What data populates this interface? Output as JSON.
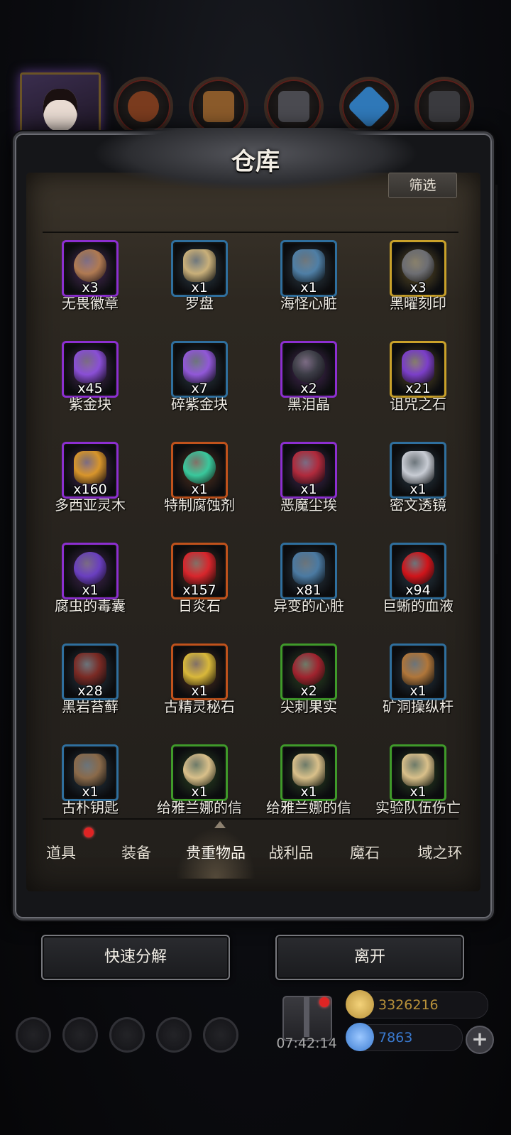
{
  "warehouse": {
    "title": "仓库",
    "filter_label": "筛选"
  },
  "items": [
    {
      "name": "无畏徽章",
      "qty": "x3",
      "rarity": "purple",
      "icon": "rune-medal-icon",
      "icon_color": "#b07a52"
    },
    {
      "name": "罗盘",
      "qty": "x1",
      "rarity": "blue",
      "icon": "compass-icon",
      "icon_color": "#c9b07a"
    },
    {
      "name": "海怪心脏",
      "qty": "x1",
      "rarity": "blue",
      "icon": "heart-icon",
      "icon_color": "#4f7fa6"
    },
    {
      "name": "黑曜刻印",
      "qty": "x3",
      "rarity": "gold",
      "icon": "obsidian-stone-icon",
      "icon_color": "#6d6e73"
    },
    {
      "name": "紫金块",
      "qty": "x45",
      "rarity": "purple",
      "icon": "crystal-icon",
      "icon_color": "#8a4fd6"
    },
    {
      "name": "碎紫金块",
      "qty": "x7",
      "rarity": "blue",
      "icon": "crystal-shard-icon",
      "icon_color": "#9158d8"
    },
    {
      "name": "黑泪晶",
      "qty": "x2",
      "rarity": "purple",
      "icon": "black-tear-icon",
      "icon_color": "#3b3c45"
    },
    {
      "name": "诅咒之石",
      "qty": "x21",
      "rarity": "gold",
      "icon": "cursed-stone-icon",
      "icon_color": "#7b3ec9"
    },
    {
      "name": "多西亚灵木",
      "qty": "x160",
      "rarity": "purple",
      "icon": "wood-log-icon",
      "icon_color": "#d8952b"
    },
    {
      "name": "特制腐蚀剂",
      "qty": "x1",
      "rarity": "orange",
      "icon": "potion-flask-icon",
      "icon_color": "#39c89c"
    },
    {
      "name": "恶魔尘埃",
      "qty": "x1",
      "rarity": "purple",
      "icon": "dust-pile-icon",
      "icon_color": "#b02a3c"
    },
    {
      "name": "密文透镜",
      "qty": "x1",
      "rarity": "blue",
      "icon": "lens-icon",
      "icon_color": "#c8ccd4"
    },
    {
      "name": "腐虫的毒囊",
      "qty": "x1",
      "rarity": "purple",
      "icon": "poison-sac-icon",
      "icon_color": "#6a3fc0"
    },
    {
      "name": "日炎石",
      "qty": "x157",
      "rarity": "orange",
      "icon": "ember-stone-icon",
      "icon_color": "#d8262c"
    },
    {
      "name": "异变的心脏",
      "qty": "x81",
      "rarity": "blue",
      "icon": "mutant-heart-icon",
      "icon_color": "#4b7aa2"
    },
    {
      "name": "巨蜥的血液",
      "qty": "x94",
      "rarity": "blue",
      "icon": "blood-drop-icon",
      "icon_color": "#d0141a"
    },
    {
      "name": "黑岩苔藓",
      "qty": "x28",
      "rarity": "blue",
      "icon": "moss-icon",
      "icon_color": "#7a2a24"
    },
    {
      "name": "古精灵秘石",
      "qty": "x1",
      "rarity": "orange",
      "icon": "elf-stone-icon",
      "icon_color": "#d9b83a"
    },
    {
      "name": "尖刺果实",
      "qty": "x2",
      "rarity": "green",
      "icon": "spiked-fruit-icon",
      "icon_color": "#a0232e"
    },
    {
      "name": "矿洞操纵杆",
      "qty": "x1",
      "rarity": "blue",
      "icon": "gear-lever-icon",
      "icon_color": "#b0763a"
    },
    {
      "name": "古朴钥匙",
      "qty": "x1",
      "rarity": "blue",
      "icon": "key-icon",
      "icon_color": "#8a6a4a"
    },
    {
      "name": "给雅兰娜的信",
      "qty": "x1",
      "rarity": "green",
      "icon": "letter-scroll-icon",
      "icon_color": "#d9c08a"
    },
    {
      "name": "给雅兰娜的信",
      "qty": "x1",
      "rarity": "green",
      "icon": "letter-scroll-icon",
      "icon_color": "#d9c08a"
    },
    {
      "name": "实验队伍伤亡",
      "qty": "x1",
      "rarity": "green",
      "icon": "letter-scroll-icon",
      "icon_color": "#d9c08a"
    }
  ],
  "rarity_colors": {
    "purple": "#8c2fd0",
    "blue": "#2f6f9e",
    "gold": "#c9a12a",
    "orange": "#c0521c",
    "green": "#3f9a2a"
  },
  "tabs": [
    {
      "label": "道具",
      "active": false,
      "has_alert": true
    },
    {
      "label": "装备",
      "active": false,
      "has_alert": false
    },
    {
      "label": "贵重物品",
      "active": true,
      "has_alert": false
    },
    {
      "label": "战利品",
      "active": false,
      "has_alert": false
    },
    {
      "label": "魔石",
      "active": false,
      "has_alert": false
    },
    {
      "label": "域之环",
      "active": false,
      "has_alert": false
    }
  ],
  "actions": {
    "quick_disassemble": "快速分解",
    "leave": "离开"
  },
  "hud": {
    "clock": "07:42:14",
    "gold": "3326216",
    "gems": "7863",
    "gold_color": "#b8913a",
    "gem_color": "#3a7ad0"
  }
}
